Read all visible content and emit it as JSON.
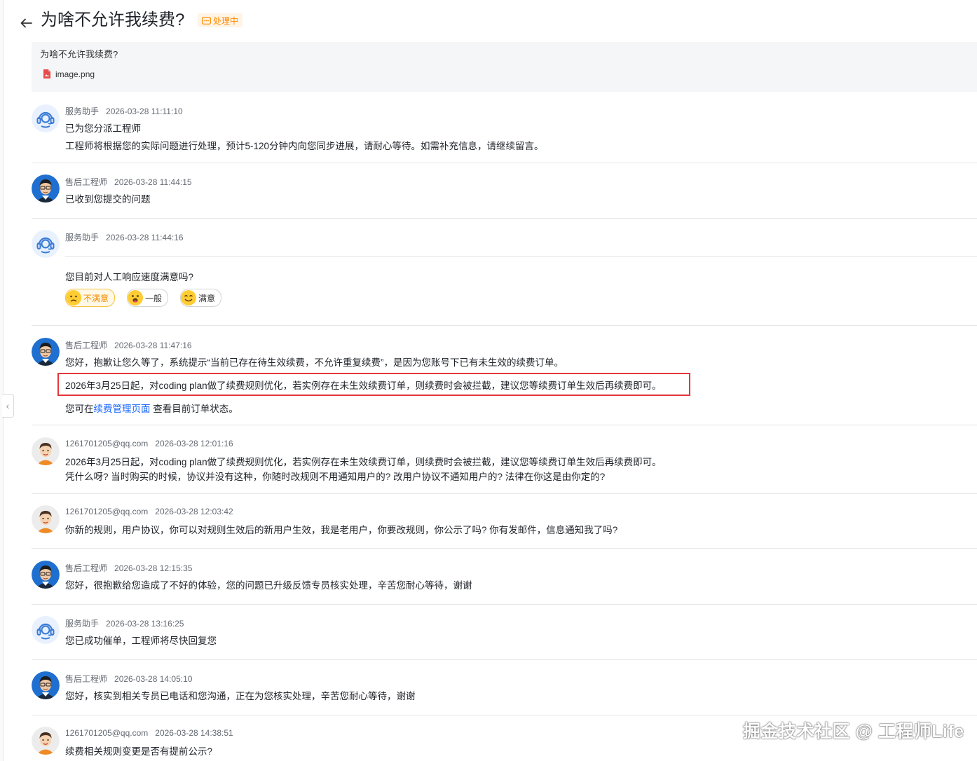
{
  "header": {
    "title": "为啥不允许我续费?",
    "status": "处理中"
  },
  "question": {
    "text": "为啥不允许我续费?",
    "attachment": "image.png"
  },
  "messages": [
    {
      "sender": "服务助手",
      "time": "2026-03-28 11:11:10",
      "lines": [
        "已为您分派工程师",
        "工程师将根据您的实际问题进行处理，预计5-120分钟内向您同步进展，请耐心等待。如需补充信息，请继续留言。"
      ]
    },
    {
      "sender": "售后工程师",
      "time": "2026-03-28 11:44:15",
      "lines": [
        "已收到您提交的问题"
      ]
    },
    {
      "sender": "服务助手",
      "time": "2026-03-28 11:44:16",
      "lines": [
        "您目前对人工响应速度满意吗?"
      ],
      "rating": [
        "不满意",
        "一般",
        "满意"
      ]
    },
    {
      "sender": "售后工程师",
      "time": "2026-03-28 11:47:16",
      "lines": [
        "您好，抱歉让您久等了，系统提示“当前已存在待生效续费，不允许重复续费”，是因为您账号下已有未生效的续费订单。",
        "2026年3月25日起，对coding plan做了续费规则优化，若实例存在未生效续费订单，则续费时会被拦截，建议您等续费订单生效后再续费即可。"
      ],
      "link_prefix": "您可在",
      "link_text": "续费管理页面",
      "link_suffix": " 查看目前订单状态。"
    },
    {
      "sender": "1261701205@qq.com",
      "time": "2026-03-28 12:01:16",
      "lines": [
        "2026年3月25日起，对coding plan做了续费规则优化，若实例存在未生效续费订单，则续费时会被拦截，建议您等续费订单生效后再续费即可。",
        "凭什么呀? 当时购买的时候，协议并没有这种，你随时改规则不用通知用户的? 改用户协议不通知用户的? 法律在你这是由你定的?"
      ]
    },
    {
      "sender": "1261701205@qq.com",
      "time": "2026-03-28 12:03:42",
      "lines": [
        "你新的规则，用户协议，你可以对规则生效后的新用户生效，我是老用户，你要改规则，你公示了吗? 你有发邮件，信息通知我了吗?"
      ]
    },
    {
      "sender": "售后工程师",
      "time": "2026-03-28 12:15:35",
      "lines": [
        "您好，很抱歉给您造成了不好的体验，您的问题已升级反馈专员核实处理，辛苦您耐心等待，谢谢"
      ]
    },
    {
      "sender": "服务助手",
      "time": "2026-03-28 13:16:25",
      "lines": [
        "您已成功催单，工程师将尽快回复您"
      ]
    },
    {
      "sender": "售后工程师",
      "time": "2026-03-28 14:05:10",
      "lines": [
        "您好，核实到相关专员已电话和您沟通，正在为您核实处理，辛苦您耐心等待，谢谢"
      ]
    },
    {
      "sender": "1261701205@qq.com",
      "time": "2026-03-28 14:38:51",
      "lines": [
        "续费相关规则变更是否有提前公示?"
      ]
    }
  ],
  "watermark": "掘金技术社区 @ 工程师Life",
  "colors": {
    "accent_link": "#1664ff",
    "status_orange": "#ff8800",
    "highlight_red": "#e5363b"
  }
}
